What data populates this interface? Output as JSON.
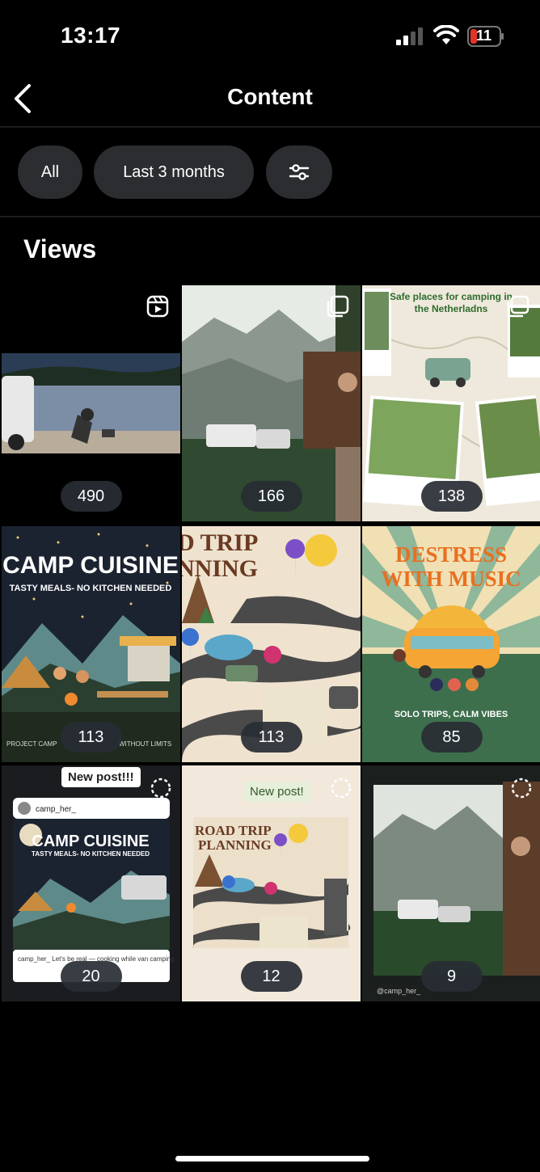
{
  "status_bar": {
    "time": "13:17",
    "battery": "11"
  },
  "header": {
    "title": "Content"
  },
  "filters": {
    "all_label": "All",
    "range_label": "Last 3 months"
  },
  "section": {
    "title": "Views"
  },
  "posts": [
    {
      "views": "490",
      "type": "reel"
    },
    {
      "views": "166",
      "type": "carousel"
    },
    {
      "views": "138",
      "type": "carousel",
      "overlay": "Safe places for camping in the Netherladns"
    },
    {
      "views": "113",
      "type": "post",
      "overlay": "CAMP CUISINE",
      "subtitle": "TASTY MEALS- NO KITCHEN NEEDED"
    },
    {
      "views": "113",
      "type": "post",
      "overlay": "D TRIP NNING"
    },
    {
      "views": "85",
      "type": "post",
      "overlay": "DESTRESS WITH MUSIC",
      "subtitle": "SOLO TRIPS, CALM VIBES"
    },
    {
      "views": "20",
      "type": "story",
      "tag": "New post!!!",
      "overlay": "CAMP CUISINE",
      "handle": "camp_her_"
    },
    {
      "views": "12",
      "type": "story",
      "tag": "New post!",
      "overlay": "ROAD TRIP PLANNING"
    },
    {
      "views": "9",
      "type": "story",
      "handle": "@camp_her_"
    }
  ],
  "colors": {
    "chip_bg": "#2b2d31",
    "badge_bg": "#282c34",
    "accent": "#ffffff"
  }
}
